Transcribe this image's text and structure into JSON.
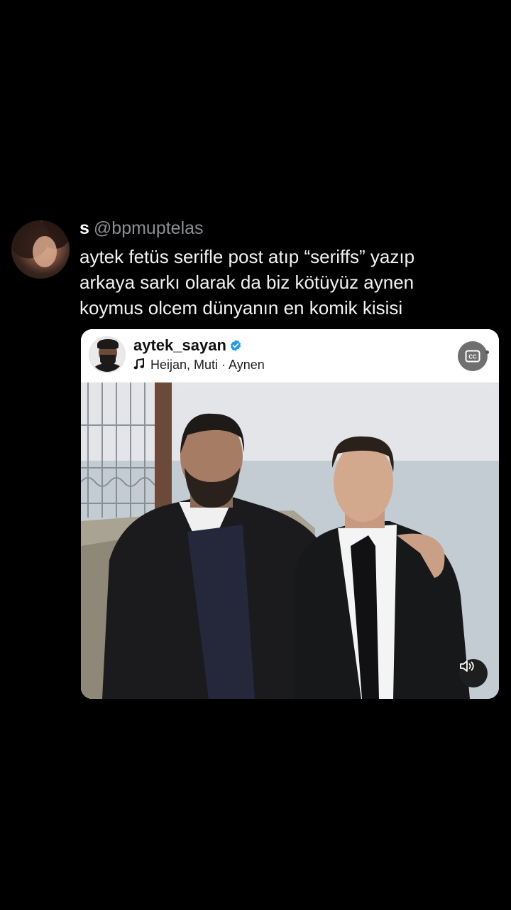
{
  "tweet": {
    "author_name": "s",
    "author_handle": "@bpmuptelas",
    "text_lines": [
      "aytek fetüs serifle post atıp “seriffs” yazıp",
      "arkaya sarkı olarak da biz kötüyüz aynen",
      "koymus olcem dünyanın en komik kisisi"
    ]
  },
  "embed": {
    "username": "aytek_sayan",
    "verified": true,
    "music": "Heijan, Muti · Aynen",
    "icons": {
      "verified": "verified-badge-icon",
      "music": "music-note-icon",
      "captions": "cc-icon",
      "sound": "speaker-icon"
    },
    "colors": {
      "verified": "#1d9bf0",
      "card_bg": "#ffffff",
      "caption_btn": "#6f6f6f"
    }
  }
}
